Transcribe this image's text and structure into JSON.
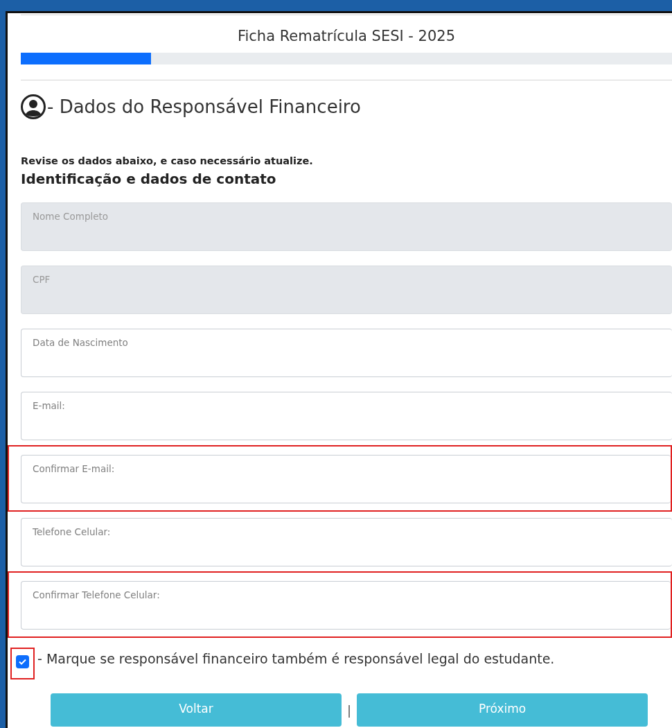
{
  "form_title": "Ficha Rematrícula SESI - 2025",
  "progress": {
    "level": 0.2
  },
  "section_title": "- Dados do Responsável Financeiro",
  "instruction": "Revise os dados abaixo, e caso necessário atualize.",
  "subsection_title": "Identificação e dados de contato",
  "fields": [
    {
      "label": "Nome Completo",
      "disabled": true,
      "highlighted": false
    },
    {
      "label": "CPF",
      "disabled": true,
      "highlighted": false
    },
    {
      "label": "Data de Nascimento",
      "disabled": false,
      "highlighted": false
    },
    {
      "label": "E-mail:",
      "disabled": false,
      "highlighted": false
    },
    {
      "label": "Confirmar E-mail:",
      "disabled": false,
      "highlighted": true
    },
    {
      "label": "Telefone Celular:",
      "disabled": false,
      "highlighted": false
    },
    {
      "label": "Confirmar Telefone Celular:",
      "disabled": false,
      "highlighted": true
    }
  ],
  "legal_guardian_checkbox": {
    "checked": true,
    "highlighted": true,
    "label": "- Marque se responsável financeiro também é responsável legal do estudante."
  },
  "buttons": {
    "back": "Voltar",
    "separator": "|",
    "next": "Próximo"
  }
}
